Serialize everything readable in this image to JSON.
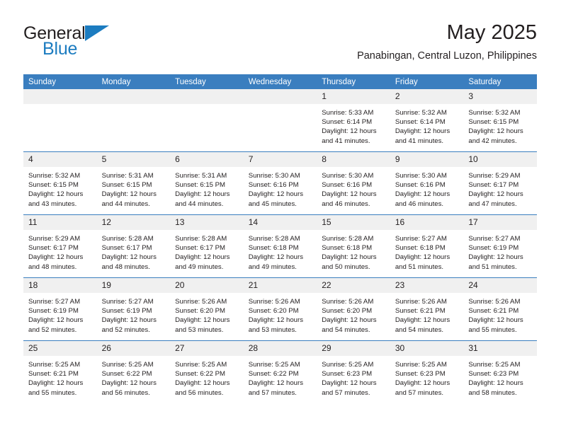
{
  "brand": {
    "name_top": "General",
    "name_bottom": "Blue",
    "accent_color": "#1c7cc0",
    "text_color": "#231f20"
  },
  "header": {
    "title": "May 2025",
    "subtitle": "Panabingan, Central Luzon, Philippines"
  },
  "theme": {
    "header_bg": "#3a7ebf",
    "header_text": "#ffffff",
    "daynum_bg": "#f0f0f0",
    "cell_bg": "#ffffff",
    "row_divider": "#3a7ebf"
  },
  "weekdays": [
    "Sunday",
    "Monday",
    "Tuesday",
    "Wednesday",
    "Thursday",
    "Friday",
    "Saturday"
  ],
  "calendar": {
    "month": "May",
    "year": "2025",
    "weeks": [
      [
        {
          "day": "",
          "sunrise": "",
          "sunset": "",
          "daylight_1": "",
          "daylight_2": ""
        },
        {
          "day": "",
          "sunrise": "",
          "sunset": "",
          "daylight_1": "",
          "daylight_2": ""
        },
        {
          "day": "",
          "sunrise": "",
          "sunset": "",
          "daylight_1": "",
          "daylight_2": ""
        },
        {
          "day": "",
          "sunrise": "",
          "sunset": "",
          "daylight_1": "",
          "daylight_2": ""
        },
        {
          "day": "1",
          "sunrise": "Sunrise: 5:33 AM",
          "sunset": "Sunset: 6:14 PM",
          "daylight_1": "Daylight: 12 hours",
          "daylight_2": "and 41 minutes."
        },
        {
          "day": "2",
          "sunrise": "Sunrise: 5:32 AM",
          "sunset": "Sunset: 6:14 PM",
          "daylight_1": "Daylight: 12 hours",
          "daylight_2": "and 41 minutes."
        },
        {
          "day": "3",
          "sunrise": "Sunrise: 5:32 AM",
          "sunset": "Sunset: 6:15 PM",
          "daylight_1": "Daylight: 12 hours",
          "daylight_2": "and 42 minutes."
        }
      ],
      [
        {
          "day": "4",
          "sunrise": "Sunrise: 5:32 AM",
          "sunset": "Sunset: 6:15 PM",
          "daylight_1": "Daylight: 12 hours",
          "daylight_2": "and 43 minutes."
        },
        {
          "day": "5",
          "sunrise": "Sunrise: 5:31 AM",
          "sunset": "Sunset: 6:15 PM",
          "daylight_1": "Daylight: 12 hours",
          "daylight_2": "and 44 minutes."
        },
        {
          "day": "6",
          "sunrise": "Sunrise: 5:31 AM",
          "sunset": "Sunset: 6:15 PM",
          "daylight_1": "Daylight: 12 hours",
          "daylight_2": "and 44 minutes."
        },
        {
          "day": "7",
          "sunrise": "Sunrise: 5:30 AM",
          "sunset": "Sunset: 6:16 PM",
          "daylight_1": "Daylight: 12 hours",
          "daylight_2": "and 45 minutes."
        },
        {
          "day": "8",
          "sunrise": "Sunrise: 5:30 AM",
          "sunset": "Sunset: 6:16 PM",
          "daylight_1": "Daylight: 12 hours",
          "daylight_2": "and 46 minutes."
        },
        {
          "day": "9",
          "sunrise": "Sunrise: 5:30 AM",
          "sunset": "Sunset: 6:16 PM",
          "daylight_1": "Daylight: 12 hours",
          "daylight_2": "and 46 minutes."
        },
        {
          "day": "10",
          "sunrise": "Sunrise: 5:29 AM",
          "sunset": "Sunset: 6:17 PM",
          "daylight_1": "Daylight: 12 hours",
          "daylight_2": "and 47 minutes."
        }
      ],
      [
        {
          "day": "11",
          "sunrise": "Sunrise: 5:29 AM",
          "sunset": "Sunset: 6:17 PM",
          "daylight_1": "Daylight: 12 hours",
          "daylight_2": "and 48 minutes."
        },
        {
          "day": "12",
          "sunrise": "Sunrise: 5:28 AM",
          "sunset": "Sunset: 6:17 PM",
          "daylight_1": "Daylight: 12 hours",
          "daylight_2": "and 48 minutes."
        },
        {
          "day": "13",
          "sunrise": "Sunrise: 5:28 AM",
          "sunset": "Sunset: 6:17 PM",
          "daylight_1": "Daylight: 12 hours",
          "daylight_2": "and 49 minutes."
        },
        {
          "day": "14",
          "sunrise": "Sunrise: 5:28 AM",
          "sunset": "Sunset: 6:18 PM",
          "daylight_1": "Daylight: 12 hours",
          "daylight_2": "and 49 minutes."
        },
        {
          "day": "15",
          "sunrise": "Sunrise: 5:28 AM",
          "sunset": "Sunset: 6:18 PM",
          "daylight_1": "Daylight: 12 hours",
          "daylight_2": "and 50 minutes."
        },
        {
          "day": "16",
          "sunrise": "Sunrise: 5:27 AM",
          "sunset": "Sunset: 6:18 PM",
          "daylight_1": "Daylight: 12 hours",
          "daylight_2": "and 51 minutes."
        },
        {
          "day": "17",
          "sunrise": "Sunrise: 5:27 AM",
          "sunset": "Sunset: 6:19 PM",
          "daylight_1": "Daylight: 12 hours",
          "daylight_2": "and 51 minutes."
        }
      ],
      [
        {
          "day": "18",
          "sunrise": "Sunrise: 5:27 AM",
          "sunset": "Sunset: 6:19 PM",
          "daylight_1": "Daylight: 12 hours",
          "daylight_2": "and 52 minutes."
        },
        {
          "day": "19",
          "sunrise": "Sunrise: 5:27 AM",
          "sunset": "Sunset: 6:19 PM",
          "daylight_1": "Daylight: 12 hours",
          "daylight_2": "and 52 minutes."
        },
        {
          "day": "20",
          "sunrise": "Sunrise: 5:26 AM",
          "sunset": "Sunset: 6:20 PM",
          "daylight_1": "Daylight: 12 hours",
          "daylight_2": "and 53 minutes."
        },
        {
          "day": "21",
          "sunrise": "Sunrise: 5:26 AM",
          "sunset": "Sunset: 6:20 PM",
          "daylight_1": "Daylight: 12 hours",
          "daylight_2": "and 53 minutes."
        },
        {
          "day": "22",
          "sunrise": "Sunrise: 5:26 AM",
          "sunset": "Sunset: 6:20 PM",
          "daylight_1": "Daylight: 12 hours",
          "daylight_2": "and 54 minutes."
        },
        {
          "day": "23",
          "sunrise": "Sunrise: 5:26 AM",
          "sunset": "Sunset: 6:21 PM",
          "daylight_1": "Daylight: 12 hours",
          "daylight_2": "and 54 minutes."
        },
        {
          "day": "24",
          "sunrise": "Sunrise: 5:26 AM",
          "sunset": "Sunset: 6:21 PM",
          "daylight_1": "Daylight: 12 hours",
          "daylight_2": "and 55 minutes."
        }
      ],
      [
        {
          "day": "25",
          "sunrise": "Sunrise: 5:25 AM",
          "sunset": "Sunset: 6:21 PM",
          "daylight_1": "Daylight: 12 hours",
          "daylight_2": "and 55 minutes."
        },
        {
          "day": "26",
          "sunrise": "Sunrise: 5:25 AM",
          "sunset": "Sunset: 6:22 PM",
          "daylight_1": "Daylight: 12 hours",
          "daylight_2": "and 56 minutes."
        },
        {
          "day": "27",
          "sunrise": "Sunrise: 5:25 AM",
          "sunset": "Sunset: 6:22 PM",
          "daylight_1": "Daylight: 12 hours",
          "daylight_2": "and 56 minutes."
        },
        {
          "day": "28",
          "sunrise": "Sunrise: 5:25 AM",
          "sunset": "Sunset: 6:22 PM",
          "daylight_1": "Daylight: 12 hours",
          "daylight_2": "and 57 minutes."
        },
        {
          "day": "29",
          "sunrise": "Sunrise: 5:25 AM",
          "sunset": "Sunset: 6:23 PM",
          "daylight_1": "Daylight: 12 hours",
          "daylight_2": "and 57 minutes."
        },
        {
          "day": "30",
          "sunrise": "Sunrise: 5:25 AM",
          "sunset": "Sunset: 6:23 PM",
          "daylight_1": "Daylight: 12 hours",
          "daylight_2": "and 57 minutes."
        },
        {
          "day": "31",
          "sunrise": "Sunrise: 5:25 AM",
          "sunset": "Sunset: 6:23 PM",
          "daylight_1": "Daylight: 12 hours",
          "daylight_2": "and 58 minutes."
        }
      ]
    ]
  }
}
